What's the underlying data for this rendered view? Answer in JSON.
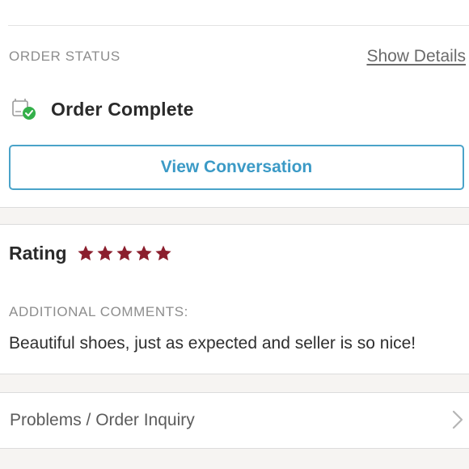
{
  "order_status": {
    "section_label": "ORDER STATUS",
    "show_details_label": "Show Details",
    "status_text": "Order Complete",
    "view_conversation_label": "View Conversation"
  },
  "rating": {
    "label": "Rating",
    "stars": 5,
    "max_stars": 5,
    "star_color": "#8b1e2d"
  },
  "comments": {
    "section_label": "ADDITIONAL COMMENTS:",
    "text": "Beautiful shoes, just as expected and seller is so nice!"
  },
  "problems": {
    "label": "Problems / Order Inquiry"
  },
  "icons": {
    "status": "order-complete-icon",
    "star": "star-icon",
    "chevron": "chevron-right-icon"
  },
  "colors": {
    "accent": "#3b9ac6",
    "success": "#34b04a",
    "label_gray": "#8d8d8d"
  }
}
